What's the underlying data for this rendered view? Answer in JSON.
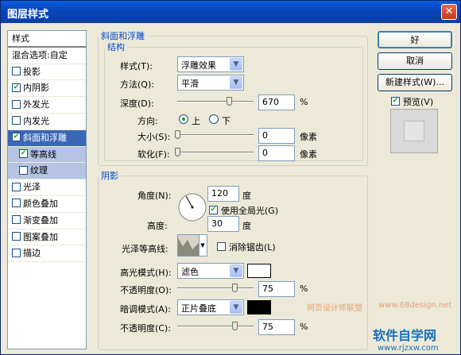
{
  "title": "图层样式",
  "sidebar": {
    "header": "样式",
    "blend": "混合选项:自定",
    "items": [
      {
        "label": "投影",
        "checked": false
      },
      {
        "label": "内阴影",
        "checked": true
      },
      {
        "label": "外发光",
        "checked": false
      },
      {
        "label": "内发光",
        "checked": false
      },
      {
        "label": "斜面和浮雕",
        "checked": true
      },
      {
        "label": "等高线",
        "checked": true
      },
      {
        "label": "纹理",
        "checked": false
      },
      {
        "label": "光泽",
        "checked": false
      },
      {
        "label": "颜色叠加",
        "checked": false
      },
      {
        "label": "渐变叠加",
        "checked": false
      },
      {
        "label": "图案叠加",
        "checked": false
      },
      {
        "label": "描边",
        "checked": false
      }
    ]
  },
  "bevel": {
    "legend": "斜面和浮雕",
    "structure": "结构",
    "style_label": "样式(T):",
    "style_value": "浮雕效果",
    "technique_label": "方法(Q):",
    "technique_value": "平滑",
    "depth_label": "深度(D):",
    "depth_value": "670",
    "depth_unit": "%",
    "depth_level": 0.68,
    "direction_label": "方向:",
    "dir_up": "上",
    "dir_down": "下",
    "size_label": "大小(S):",
    "size_value": "0",
    "size_unit": "像素",
    "size_level": 0,
    "soften_label": "软化(F):",
    "soften_value": "0",
    "soften_unit": "像素",
    "soften_level": 0
  },
  "shading": {
    "legend": "阴影",
    "angle_label": "角度(N):",
    "angle_value": "120",
    "angle_unit": "度",
    "global_light": "使用全局光(G)",
    "altitude_label": "高度:",
    "altitude_value": "30",
    "altitude_unit": "度",
    "gloss_label": "光泽等高线:",
    "antialias": "消除锯齿(L)",
    "hl_mode_label": "高光模式(H):",
    "hl_mode_value": "滤色",
    "hl_color": "#ffffff",
    "hl_opacity_label": "不透明度(O):",
    "hl_opacity_value": "75",
    "hl_opacity_unit": "%",
    "hl_opacity_level": 0.75,
    "sh_mode_label": "暗调模式(A):",
    "sh_mode_value": "正片叠底",
    "sh_color": "#000000",
    "sh_opacity_label": "不透明度(C):",
    "sh_opacity_value": "75",
    "sh_opacity_unit": "%",
    "sh_opacity_level": 0.75
  },
  "buttons": {
    "ok": "好",
    "cancel": "取消",
    "new_style": "新建样式(W)...",
    "preview": "预览(V)"
  },
  "watermarks": {
    "site_cn": "网页设计师联盟",
    "site_url": "www.68design.net",
    "brand": "软件自学网",
    "brand_url": "www.rjzxw.com"
  }
}
